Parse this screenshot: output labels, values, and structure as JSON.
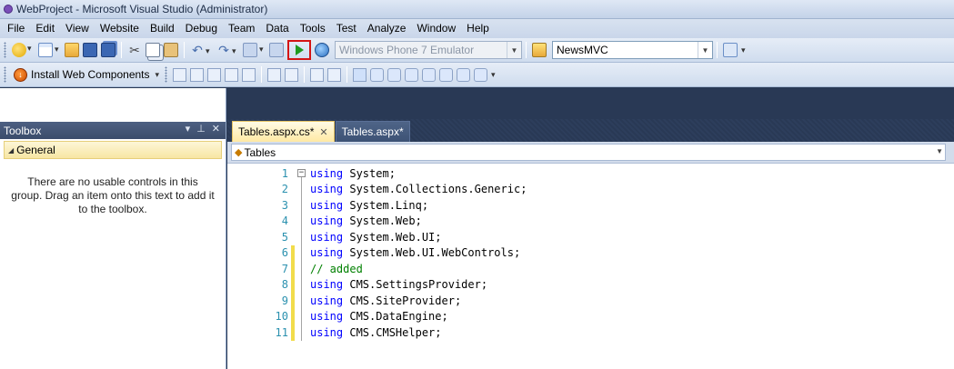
{
  "window": {
    "title": "WebProject - Microsoft Visual Studio (Administrator)"
  },
  "menu": [
    "File",
    "Edit",
    "View",
    "Website",
    "Build",
    "Debug",
    "Team",
    "Data",
    "Tools",
    "Test",
    "Analyze",
    "Window",
    "Help"
  ],
  "toolbar": {
    "target_device": "Windows Phone 7 Emulator",
    "solution_config": "NewsMVC"
  },
  "toolbar2": {
    "install_label": "Install Web Components"
  },
  "toolbox": {
    "title": "Toolbox",
    "group": "General",
    "empty_message": "There are no usable controls in this group. Drag an item onto this text to add it to the toolbox."
  },
  "tabs": [
    {
      "label": "Tables.aspx.cs*",
      "active": true
    },
    {
      "label": "Tables.aspx*",
      "active": false
    }
  ],
  "navbar": {
    "class": "Tables"
  },
  "code": [
    {
      "n": "1",
      "kw": "using",
      "rest": " System;",
      "changed": false,
      "outline": "box"
    },
    {
      "n": "2",
      "kw": "using",
      "rest": " System.Collections.Generic;",
      "changed": false,
      "outline": "bar"
    },
    {
      "n": "3",
      "kw": "using",
      "rest": " System.Linq;",
      "changed": false,
      "outline": "bar"
    },
    {
      "n": "4",
      "kw": "using",
      "rest": " System.Web;",
      "changed": false,
      "outline": "bar"
    },
    {
      "n": "5",
      "kw": "using",
      "rest": " System.Web.UI;",
      "changed": false,
      "outline": "bar"
    },
    {
      "n": "6",
      "kw": "using",
      "rest": " System.Web.UI.WebControls;",
      "changed": true,
      "outline": "bar"
    },
    {
      "n": "7",
      "comment": "// added",
      "changed": true,
      "outline": "bar"
    },
    {
      "n": "8",
      "kw": "using",
      "rest": " CMS.SettingsProvider;",
      "changed": true,
      "outline": "bar"
    },
    {
      "n": "9",
      "kw": "using",
      "rest": " CMS.SiteProvider;",
      "changed": true,
      "outline": "bar"
    },
    {
      "n": "10",
      "kw": "using",
      "rest": " CMS.DataEngine;",
      "changed": true,
      "outline": "bar"
    },
    {
      "n": "11",
      "kw": "using",
      "rest": " CMS.CMSHelper;",
      "changed": true,
      "outline": "bar"
    }
  ]
}
